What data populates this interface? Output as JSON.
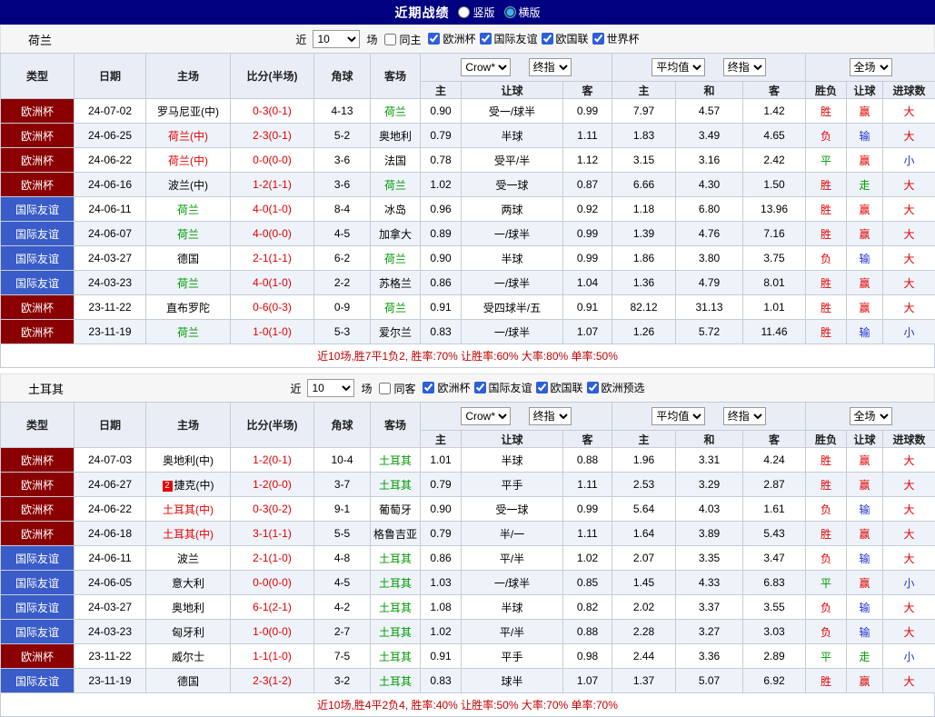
{
  "top_bar": {
    "title": "近期战绩",
    "radios": [
      {
        "label": "竖版",
        "selected": false
      },
      {
        "label": "横版",
        "selected": true
      }
    ]
  },
  "table_header": {
    "type": "类型",
    "date": "日期",
    "home": "主场",
    "score": "比分(半场)",
    "corner": "角球",
    "away": "客场",
    "dd_bookmaker": "Crow*",
    "dd_final1": "终指",
    "dd_average": "平均值",
    "dd_final2": "终指",
    "dd_scope": "全场",
    "sub_labels": [
      "主",
      "让球",
      "客",
      "主",
      "和",
      "客",
      "胜负",
      "让球",
      "进球数"
    ]
  },
  "colors": {
    "topbar_navy": "#000080",
    "cup_badge": "#8a0000",
    "friendly_badge": "#3a5cc8",
    "team_green": "#009900",
    "team_red": "#e60000",
    "score_red": "#e00000",
    "win_red": "#e60000",
    "draw_green": "#009933",
    "lose_blue": "#2233cc",
    "summary_red": "#c00000"
  },
  "sections": [
    {
      "team": "荷兰",
      "filters": {
        "near": "近",
        "count": "10",
        "games": "场",
        "same": {
          "label": "同主",
          "checked": false
        },
        "leagues": [
          {
            "label": "欧洲杯",
            "checked": true
          },
          {
            "label": "国际友谊",
            "checked": true
          },
          {
            "label": "欧国联",
            "checked": true
          },
          {
            "label": "世界杯",
            "checked": true
          }
        ]
      },
      "rows": [
        {
          "league": "欧洲杯",
          "lt": "cup",
          "date": "24-07-02",
          "home": "罗马尼亚(中)",
          "hc": "k",
          "score": "0-3(0-1)",
          "corner": "4-13",
          "away": "荷兰",
          "ac": "g",
          "o1": "0.90",
          "h": "受一/球半",
          "o2": "0.99",
          "a1": "7.97",
          "a2": "4.57",
          "a3": "1.42",
          "r1": "胜",
          "r1c": "r",
          "r2": "赢",
          "r2c": "r",
          "r3": "大",
          "r3c": "r"
        },
        {
          "league": "欧洲杯",
          "lt": "cup",
          "date": "24-06-25",
          "home": "荷兰(中)",
          "hc": "r",
          "score": "2-3(0-1)",
          "corner": "5-2",
          "away": "奥地利",
          "ac": "k",
          "o1": "0.79",
          "h": "半球",
          "o2": "1.11",
          "a1": "1.83",
          "a2": "3.49",
          "a3": "4.65",
          "r1": "负",
          "r1c": "r",
          "r2": "输",
          "r2c": "b",
          "r3": "大",
          "r3c": "r"
        },
        {
          "league": "欧洲杯",
          "lt": "cup",
          "date": "24-06-22",
          "home": "荷兰(中)",
          "hc": "r",
          "score": "0-0(0-0)",
          "corner": "3-6",
          "away": "法国",
          "ac": "k",
          "o1": "0.78",
          "h": "受平/半",
          "o2": "1.12",
          "a1": "3.15",
          "a2": "3.16",
          "a3": "2.42",
          "r1": "平",
          "r1c": "g",
          "r2": "赢",
          "r2c": "r",
          "r3": "小",
          "r3c": "b"
        },
        {
          "league": "欧洲杯",
          "lt": "cup",
          "date": "24-06-16",
          "home": "波兰(中)",
          "hc": "k",
          "score": "1-2(1-1)",
          "corner": "3-6",
          "away": "荷兰",
          "ac": "g",
          "o1": "1.02",
          "h": "受一球",
          "o2": "0.87",
          "a1": "6.66",
          "a2": "4.30",
          "a3": "1.50",
          "r1": "胜",
          "r1c": "r",
          "r2": "走",
          "r2c": "g",
          "r3": "大",
          "r3c": "r"
        },
        {
          "league": "国际友谊",
          "lt": "friendly",
          "date": "24-06-11",
          "home": "荷兰",
          "hc": "g",
          "score": "4-0(1-0)",
          "corner": "8-4",
          "away": "冰岛",
          "ac": "k",
          "o1": "0.96",
          "h": "两球",
          "o2": "0.92",
          "a1": "1.18",
          "a2": "6.80",
          "a3": "13.96",
          "r1": "胜",
          "r1c": "r",
          "r2": "赢",
          "r2c": "r",
          "r3": "大",
          "r3c": "r"
        },
        {
          "league": "国际友谊",
          "lt": "friendly",
          "date": "24-06-07",
          "home": "荷兰",
          "hc": "g",
          "score": "4-0(0-0)",
          "corner": "4-5",
          "away": "加拿大",
          "ac": "k",
          "o1": "0.89",
          "h": "一/球半",
          "o2": "0.99",
          "a1": "1.39",
          "a2": "4.76",
          "a3": "7.16",
          "r1": "胜",
          "r1c": "r",
          "r2": "赢",
          "r2c": "r",
          "r3": "大",
          "r3c": "r"
        },
        {
          "league": "国际友谊",
          "lt": "friendly",
          "date": "24-03-27",
          "home": "德国",
          "hc": "k",
          "score": "2-1(1-1)",
          "corner": "6-2",
          "away": "荷兰",
          "ac": "g",
          "o1": "0.90",
          "h": "半球",
          "o2": "0.99",
          "a1": "1.86",
          "a2": "3.80",
          "a3": "3.75",
          "r1": "负",
          "r1c": "r",
          "r2": "输",
          "r2c": "b",
          "r3": "大",
          "r3c": "r"
        },
        {
          "league": "国际友谊",
          "lt": "friendly",
          "date": "24-03-23",
          "home": "荷兰",
          "hc": "g",
          "score": "4-0(1-0)",
          "corner": "2-2",
          "away": "苏格兰",
          "ac": "k",
          "o1": "0.86",
          "h": "一/球半",
          "o2": "1.04",
          "a1": "1.36",
          "a2": "4.79",
          "a3": "8.01",
          "r1": "胜",
          "r1c": "r",
          "r2": "赢",
          "r2c": "r",
          "r3": "大",
          "r3c": "r"
        },
        {
          "league": "欧洲杯",
          "lt": "cup",
          "date": "23-11-22",
          "home": "直布罗陀",
          "hc": "k",
          "score": "0-6(0-3)",
          "corner": "0-9",
          "away": "荷兰",
          "ac": "g",
          "o1": "0.91",
          "h": "受四球半/五",
          "o2": "0.91",
          "a1": "82.12",
          "a2": "31.13",
          "a3": "1.01",
          "r1": "胜",
          "r1c": "r",
          "r2": "赢",
          "r2c": "r",
          "r3": "大",
          "r3c": "r"
        },
        {
          "league": "欧洲杯",
          "lt": "cup",
          "date": "23-11-19",
          "home": "荷兰",
          "hc": "g",
          "score": "1-0(1-0)",
          "corner": "5-3",
          "away": "爱尔兰",
          "ac": "k",
          "o1": "0.83",
          "h": "一/球半",
          "o2": "1.07",
          "a1": "1.26",
          "a2": "5.72",
          "a3": "11.46",
          "r1": "胜",
          "r1c": "r",
          "r2": "输",
          "r2c": "b",
          "r3": "小",
          "r3c": "b"
        }
      ],
      "summary": "近10场,胜7平1负2, 胜率:70%  让胜率:60%  大率:80%  单率:50%"
    },
    {
      "team": "土耳其",
      "filters": {
        "near": "近",
        "count": "10",
        "games": "场",
        "same": {
          "label": "同客",
          "checked": false
        },
        "leagues": [
          {
            "label": "欧洲杯",
            "checked": true
          },
          {
            "label": "国际友谊",
            "checked": true
          },
          {
            "label": "欧国联",
            "checked": true
          },
          {
            "label": "欧洲预选",
            "checked": true
          }
        ]
      },
      "rows": [
        {
          "league": "欧洲杯",
          "lt": "cup",
          "date": "24-07-03",
          "home": "奥地利(中)",
          "hc": "k",
          "score": "1-2(0-1)",
          "corner": "10-4",
          "away": "土耳其",
          "ac": "g",
          "o1": "1.01",
          "h": "半球",
          "o2": "0.88",
          "a1": "1.96",
          "a2": "3.31",
          "a3": "4.24",
          "r1": "胜",
          "r1c": "r",
          "r2": "赢",
          "r2c": "r",
          "r3": "大",
          "r3c": "r"
        },
        {
          "league": "欧洲杯",
          "lt": "cup",
          "date": "24-06-27",
          "home": "捷克(中)",
          "hc": "k",
          "card": "2",
          "score": "1-2(0-0)",
          "corner": "3-7",
          "away": "土耳其",
          "ac": "g",
          "o1": "0.79",
          "h": "平手",
          "o2": "1.11",
          "a1": "2.53",
          "a2": "3.29",
          "a3": "2.87",
          "r1": "胜",
          "r1c": "r",
          "r2": "赢",
          "r2c": "r",
          "r3": "大",
          "r3c": "r"
        },
        {
          "league": "欧洲杯",
          "lt": "cup",
          "date": "24-06-22",
          "home": "土耳其(中)",
          "hc": "r",
          "score": "0-3(0-2)",
          "corner": "9-1",
          "away": "葡萄牙",
          "ac": "k",
          "o1": "0.90",
          "h": "受一球",
          "o2": "0.99",
          "a1": "5.64",
          "a2": "4.03",
          "a3": "1.61",
          "r1": "负",
          "r1c": "r",
          "r2": "输",
          "r2c": "b",
          "r3": "大",
          "r3c": "r"
        },
        {
          "league": "欧洲杯",
          "lt": "cup",
          "date": "24-06-18",
          "home": "土耳其(中)",
          "hc": "r",
          "score": "3-1(1-1)",
          "corner": "5-5",
          "away": "格鲁吉亚",
          "ac": "k",
          "o1": "0.79",
          "h": "半/一",
          "o2": "1.11",
          "a1": "1.64",
          "a2": "3.89",
          "a3": "5.43",
          "r1": "胜",
          "r1c": "r",
          "r2": "赢",
          "r2c": "r",
          "r3": "大",
          "r3c": "r"
        },
        {
          "league": "国际友谊",
          "lt": "friendly",
          "date": "24-06-11",
          "home": "波兰",
          "hc": "k",
          "score": "2-1(1-0)",
          "corner": "4-8",
          "away": "土耳其",
          "ac": "g",
          "o1": "0.86",
          "h": "平/半",
          "o2": "1.02",
          "a1": "2.07",
          "a2": "3.35",
          "a3": "3.47",
          "r1": "负",
          "r1c": "r",
          "r2": "输",
          "r2c": "b",
          "r3": "大",
          "r3c": "r"
        },
        {
          "league": "国际友谊",
          "lt": "friendly",
          "date": "24-06-05",
          "home": "意大利",
          "hc": "k",
          "score": "0-0(0-0)",
          "corner": "4-5",
          "away": "土耳其",
          "ac": "g",
          "o1": "1.03",
          "h": "一/球半",
          "o2": "0.85",
          "a1": "1.45",
          "a2": "4.33",
          "a3": "6.83",
          "r1": "平",
          "r1c": "g",
          "r2": "赢",
          "r2c": "r",
          "r3": "小",
          "r3c": "b"
        },
        {
          "league": "国际友谊",
          "lt": "friendly",
          "date": "24-03-27",
          "home": "奥地利",
          "hc": "k",
          "score": "6-1(2-1)",
          "corner": "4-2",
          "away": "土耳其",
          "ac": "g",
          "o1": "1.08",
          "h": "半球",
          "o2": "0.82",
          "a1": "2.02",
          "a2": "3.37",
          "a3": "3.55",
          "r1": "负",
          "r1c": "r",
          "r2": "输",
          "r2c": "b",
          "r3": "大",
          "r3c": "r"
        },
        {
          "league": "国际友谊",
          "lt": "friendly",
          "date": "24-03-23",
          "home": "匈牙利",
          "hc": "k",
          "score": "1-0(0-0)",
          "corner": "2-7",
          "away": "土耳其",
          "ac": "g",
          "o1": "1.02",
          "h": "平/半",
          "o2": "0.88",
          "a1": "2.28",
          "a2": "3.27",
          "a3": "3.03",
          "r1": "负",
          "r1c": "r",
          "r2": "输",
          "r2c": "b",
          "r3": "大",
          "r3c": "r"
        },
        {
          "league": "欧洲杯",
          "lt": "cup",
          "date": "23-11-22",
          "home": "威尔士",
          "hc": "k",
          "score": "1-1(1-0)",
          "corner": "7-5",
          "away": "土耳其",
          "ac": "g",
          "o1": "0.91",
          "h": "平手",
          "o2": "0.98",
          "a1": "2.44",
          "a2": "3.36",
          "a3": "2.89",
          "r1": "平",
          "r1c": "g",
          "r2": "走",
          "r2c": "g",
          "r3": "小",
          "r3c": "b"
        },
        {
          "league": "国际友谊",
          "lt": "friendly",
          "date": "23-11-19",
          "home": "德国",
          "hc": "k",
          "score": "2-3(1-2)",
          "corner": "3-2",
          "away": "土耳其",
          "ac": "g",
          "o1": "0.83",
          "h": "球半",
          "o2": "1.07",
          "a1": "1.37",
          "a2": "5.07",
          "a3": "6.92",
          "r1": "胜",
          "r1c": "r",
          "r2": "赢",
          "r2c": "r",
          "r3": "大",
          "r3c": "r"
        }
      ],
      "summary": "近10场,胜4平2负4, 胜率:40%  让胜率:50%  大率:70%  单率:70%"
    }
  ]
}
